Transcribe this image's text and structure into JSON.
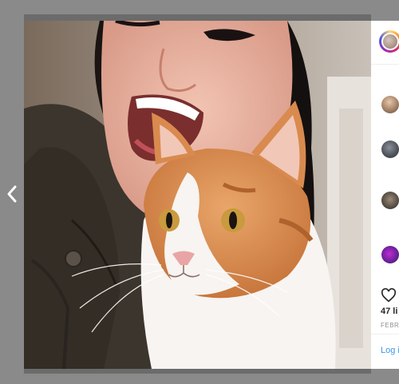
{
  "post": {
    "likes_text": "47 li",
    "date_text": "FEBR",
    "login_text": "Log i"
  },
  "icons": {
    "prev": "chevron-left-icon",
    "like": "heart-outline-icon"
  },
  "colors": {
    "overlay": "#8a8a8a",
    "panel": "#ffffff",
    "link": "#3897f0",
    "text": "#262626",
    "muted": "#8e8e8e"
  }
}
